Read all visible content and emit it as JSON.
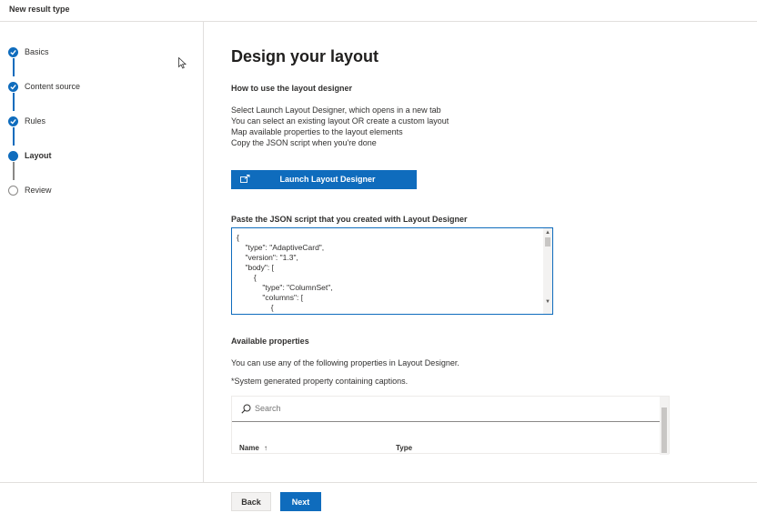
{
  "window": {
    "title": "New result type"
  },
  "steps": [
    {
      "label": "Basics",
      "state": "done"
    },
    {
      "label": "Content source",
      "state": "done"
    },
    {
      "label": "Rules",
      "state": "done"
    },
    {
      "label": "Layout",
      "state": "current"
    },
    {
      "label": "Review",
      "state": "pending"
    }
  ],
  "main": {
    "heading": "Design your layout",
    "how_to_title": "How to use the layout designer",
    "instructions": [
      "Select Launch Layout Designer, which opens in a new tab",
      "You can select an existing layout OR create a custom layout",
      "Map available properties to the layout elements",
      "Copy the JSON script when you're done"
    ],
    "launch_button": "Launch Layout Designer",
    "json_label": "Paste the JSON script that you created with Layout Designer",
    "json_value": "{\n    \"type\": \"AdaptiveCard\",\n    \"version\": \"1.3\",\n    \"body\": [\n        {\n            \"type\": \"ColumnSet\",\n            \"columns\": [\n                {\n                    \"type\": \"Column\",",
    "available_title": "Available properties",
    "available_desc": "You can use any of the following properties in Layout Designer.",
    "available_note": "*System generated property containing captions.",
    "search_placeholder": "Search",
    "columns": {
      "name": "Name",
      "sort_indicator": "↑",
      "type": "Type"
    }
  },
  "footer": {
    "back_label": "Back",
    "next_label": "Next"
  },
  "colors": {
    "accent": "#0f6cbd",
    "border": "#e1dfdd",
    "text": "#323130"
  }
}
